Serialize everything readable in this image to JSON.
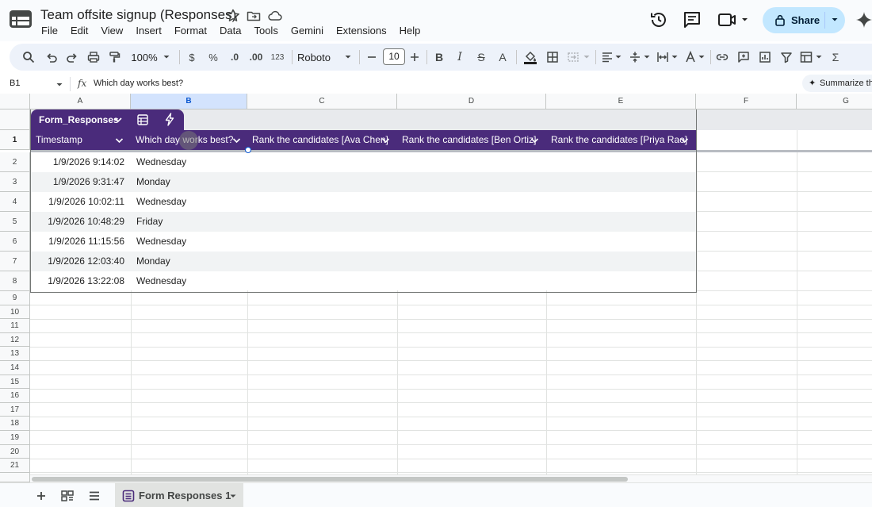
{
  "app": {
    "doc_title": "Team offsite signup (Responses)",
    "menu": [
      "File",
      "Edit",
      "View",
      "Insert",
      "Format",
      "Data",
      "Tools",
      "Gemini",
      "Extensions",
      "Help"
    ],
    "share_label": "Share"
  },
  "toolbar": {
    "zoom": "100%",
    "currency": "$",
    "percent": "%",
    "decrease_decimal": ".0",
    "increase_decimal": ".00",
    "number_format": "123",
    "font_name": "Roboto",
    "font_size": "10",
    "bold": "B",
    "italic": "I",
    "strikethrough": "S",
    "text_color": "A",
    "sum_symbol": "Σ"
  },
  "formula_bar": {
    "cell_ref": "B1",
    "fx_label": "fx",
    "content": "Which day works best?",
    "summarize_label": "Summarize th"
  },
  "grid": {
    "columns": [
      "A",
      "B",
      "C",
      "D",
      "E",
      "F",
      "G"
    ],
    "selected_column": "B",
    "rows": [
      "1",
      "2",
      "3",
      "4",
      "5",
      "6",
      "7",
      "8",
      "9",
      "10",
      "11",
      "12",
      "13",
      "14",
      "15",
      "16",
      "17",
      "18",
      "19",
      "20",
      "21"
    ]
  },
  "table": {
    "name": "Form_Responses",
    "headers": [
      "Timestamp",
      "Which day works best?",
      "Rank the candidates [Ava Chen]",
      "Rank the candidates [Ben Ortiz]",
      "Rank the candidates [Priya Rao]"
    ],
    "rows": [
      {
        "timestamp": "1/9/2026 9:14:02",
        "day": "Wednesday"
      },
      {
        "timestamp": "1/9/2026 9:31:47",
        "day": "Monday"
      },
      {
        "timestamp": "1/9/2026 10:02:11",
        "day": "Wednesday"
      },
      {
        "timestamp": "1/9/2026 10:48:29",
        "day": "Friday"
      },
      {
        "timestamp": "1/9/2026 11:15:56",
        "day": "Wednesday"
      },
      {
        "timestamp": "1/9/2026 12:03:40",
        "day": "Monday"
      },
      {
        "timestamp": "1/9/2026 13:22:08",
        "day": "Wednesday"
      }
    ]
  },
  "sheets": {
    "active_tab": "Form Responses 1"
  },
  "colors": {
    "table_header": "#4a2b7b",
    "share_button": "#c2e7ff",
    "selection": "#0b57d0",
    "selected_header": "#d3e3fd"
  }
}
